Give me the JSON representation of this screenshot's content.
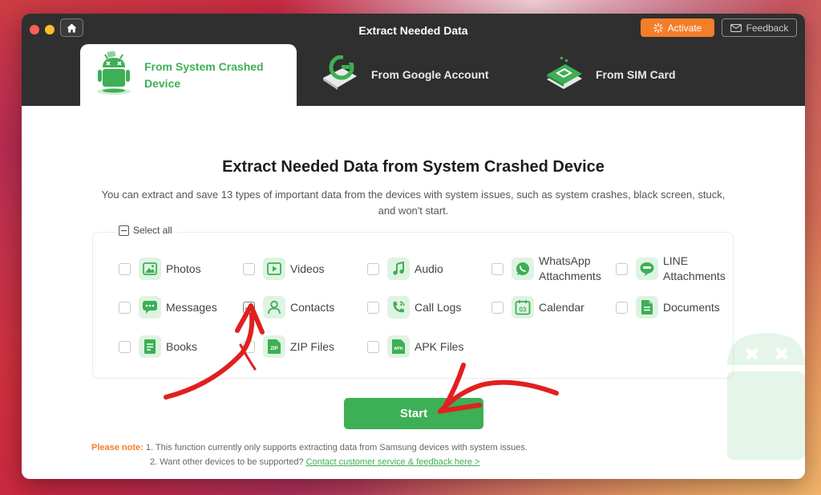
{
  "window": {
    "title": "Extract Needed Data",
    "activate_label": "Activate",
    "feedback_label": "Feedback"
  },
  "tabs": [
    {
      "label": "From System Crashed Device",
      "icon": "android-robot-icon",
      "active": true
    },
    {
      "label": "From Google Account",
      "icon": "google-account-icon",
      "active": false
    },
    {
      "label": "From SIM Card",
      "icon": "sim-card-icon",
      "active": false
    }
  ],
  "main": {
    "headline": "Extract Needed Data from System Crashed Device",
    "subtext": "You can extract and save 13 types of important data from the devices with system issues, such as system crashes, black screen, stuck, and won't start.",
    "select_all_label": "Select all",
    "items": [
      {
        "label": "Photos",
        "icon": "photos-icon",
        "checked": false
      },
      {
        "label": "Videos",
        "icon": "videos-icon",
        "checked": false
      },
      {
        "label": "Audio",
        "icon": "audio-icon",
        "checked": false
      },
      {
        "label": "WhatsApp Attachments",
        "icon": "whatsapp-icon",
        "checked": false
      },
      {
        "label": "LINE Attachments",
        "icon": "line-icon",
        "checked": false
      },
      {
        "label": "Messages",
        "icon": "messages-icon",
        "checked": false
      },
      {
        "label": "Contacts",
        "icon": "contacts-icon",
        "checked": true
      },
      {
        "label": "Call Logs",
        "icon": "call-logs-icon",
        "checked": false
      },
      {
        "label": "Calendar",
        "icon": "calendar-icon",
        "checked": false
      },
      {
        "label": "Documents",
        "icon": "documents-icon",
        "checked": false
      },
      {
        "label": "Books",
        "icon": "books-icon",
        "checked": false
      },
      {
        "label": "ZIP Files",
        "icon": "zip-files-icon",
        "checked": false
      },
      {
        "label": "APK Files",
        "icon": "apk-files-icon",
        "checked": false
      }
    ],
    "calendar_icon_text": "03",
    "zip_icon_text": "ZIP",
    "apk_icon_text": "APK",
    "start_label": "Start"
  },
  "note": {
    "label": "Please note:",
    "line1": "1. This function currently only supports extracting data from Samsung devices with system issues.",
    "line2": "2. Want other devices to be supported?",
    "link": "Contact customer service & feedback here >"
  },
  "colors": {
    "accent_green": "#3daf55",
    "activate_orange": "#f47e2a",
    "titlebar": "#2f2f2f",
    "annotation_red": "#e0201f"
  }
}
